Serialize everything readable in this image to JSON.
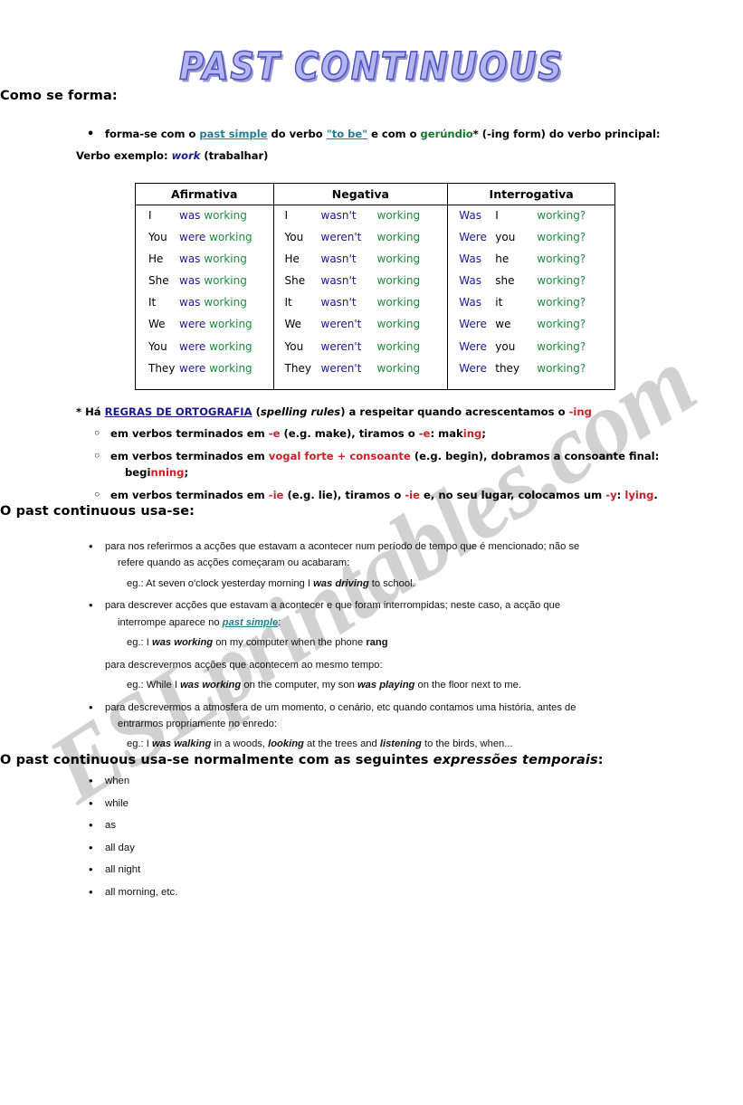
{
  "watermark": "ESLprintables.com",
  "title": "PAST CONTINUOUS",
  "how_section": {
    "heading": "Como se forma:",
    "bullet": {
      "t1": "forma-se com o ",
      "link_past_simple": "past simple",
      "t2": " do verbo ",
      "link_to_be": "\"to be\"",
      "t3": " e com o ",
      "gerundio": "gerúndio",
      "t4": "* (-ing form) do verbo principal:"
    },
    "example_line": {
      "t1": "Verbo exemplo: ",
      "verb": "work",
      "t2": " (trabalhar)"
    }
  },
  "table": {
    "headers": [
      "Afirmativa",
      "Negativa",
      "Interrogativa"
    ],
    "affirmative": [
      {
        "subject": "I",
        "aux": "was",
        "verb": "working"
      },
      {
        "subject": "You",
        "aux": "were",
        "verb": "working"
      },
      {
        "subject": "He",
        "aux": "was",
        "verb": "working"
      },
      {
        "subject": "She",
        "aux": "was",
        "verb": "working"
      },
      {
        "subject": "It",
        "aux": "was",
        "verb": "working"
      },
      {
        "subject": "We",
        "aux": "were",
        "verb": "working"
      },
      {
        "subject": "You",
        "aux": "were",
        "verb": "working"
      },
      {
        "subject": "They",
        "aux": "were",
        "verb": "working"
      }
    ],
    "negative": [
      {
        "subject": "I",
        "aux": "wasn't",
        "verb": "working"
      },
      {
        "subject": "You",
        "aux": "weren't",
        "verb": "working"
      },
      {
        "subject": "He",
        "aux": "wasn't",
        "verb": "working"
      },
      {
        "subject": "She",
        "aux": "wasn't",
        "verb": "working"
      },
      {
        "subject": "It",
        "aux": "wasn't",
        "verb": "working"
      },
      {
        "subject": "We",
        "aux": "weren't",
        "verb": "working"
      },
      {
        "subject": "You",
        "aux": "weren't",
        "verb": "working"
      },
      {
        "subject": "They",
        "aux": "weren't",
        "verb": "working"
      }
    ],
    "interrogative": [
      {
        "aux": "Was",
        "subject": "I",
        "verb": "working?"
      },
      {
        "aux": "Were",
        "subject": "you",
        "verb": "working?"
      },
      {
        "aux": "Was",
        "subject": "he",
        "verb": "working?"
      },
      {
        "aux": "Was",
        "subject": "she",
        "verb": "working?"
      },
      {
        "aux": "Was",
        "subject": "it",
        "verb": "working?"
      },
      {
        "aux": "Were",
        "subject": "we",
        "verb": "working?"
      },
      {
        "aux": "Were",
        "subject": "you",
        "verb": "working?"
      },
      {
        "aux": "Were",
        "subject": "they",
        "verb": "working?"
      }
    ]
  },
  "spelling": {
    "lead": {
      "t1": "* Há ",
      "rules_caps": "REGRAS DE ORTOGRAFIA",
      "t2": " (",
      "spelling_rules_it": "spelling rules",
      "t3": ") a respeitar quando acrescentamos o ",
      "ing": "-ing"
    },
    "rules": [
      {
        "t1": "em verbos terminados em ",
        "r1": "-e",
        "t2": " (e.g. make), tiramos o ",
        "r2": "-e",
        "t3": ": mak",
        "r3": "ing",
        "t4": ";"
      },
      {
        "t1": "em verbos terminados em ",
        "r1": "vogal forte + consoante",
        "t2": " (e.g. begin), dobramos a consoante final:",
        "cont_t1": "begi",
        "cont_r1": "nn",
        "cont_t2": "ing",
        "cont_t3": ";"
      },
      {
        "t1": "em verbos terminados em ",
        "r1": "-ie",
        "t2": " (e.g. lie), tiramos o ",
        "r2": "-ie",
        "t3": " e, no seu lugar, colocamos um ",
        "r3": "-y",
        "t4": ": ",
        "r4": "lying",
        "t5": "."
      }
    ]
  },
  "usage": {
    "heading": "O past continuous usa-se:",
    "items": [
      {
        "has_bullet": true,
        "text": "para  nos referirmos a acções que estavam a acontecer num período de tempo que é mencionado; não se",
        "cont": "refere quando as acções começaram ou acabaram:",
        "eg": {
          "prefix": "eg.: At seven o'clock yesterday morning I ",
          "bold1": "was driving",
          "mid": " to school."
        }
      },
      {
        "has_bullet": true,
        "text": "para  descrever  acções  que  estavam  a  acontecer  e  que  foram  interrompidas;  neste  caso,  a  acção  que",
        "cont_prefix": "interrompe aparece no ",
        "cont_link": "past simple",
        "cont_suffix": ":",
        "eg": {
          "prefix": "eg.: I ",
          "bold1": "was working",
          "mid": " on my computer when the phone ",
          "bold2": "rang"
        }
      },
      {
        "has_bullet": false,
        "text": "para descrevermos acções que acontecem ao mesmo tempo:",
        "eg": {
          "prefix": "eg.: While I ",
          "bold1": "was working",
          "mid": " on the computer, my son ",
          "bold2": "was playing",
          "suffix": " on the floor next to me."
        }
      },
      {
        "has_bullet": true,
        "text": "para  descrevermos  a  atmosfera  de  um  momento,  o  cenário,  etc  quando  contamos  uma  história,  antes  de",
        "cont": "entrarmos propriamente no enredo:",
        "eg": {
          "prefix": "eg.: I ",
          "bold1": "was walking",
          "mid": " in a woods, ",
          "bold2": "looking",
          "mid2": " at the trees and ",
          "bold3": "listening",
          "suffix": " to the birds, when..."
        }
      }
    ]
  },
  "expressions": {
    "heading_t1": "O past continuous usa-se normalmente com as seguintes ",
    "heading_ital": "expressões temporais",
    "heading_t2": ":",
    "items": [
      "when",
      "while",
      "as",
      "all day",
      "all night",
      "all morning, etc."
    ]
  }
}
